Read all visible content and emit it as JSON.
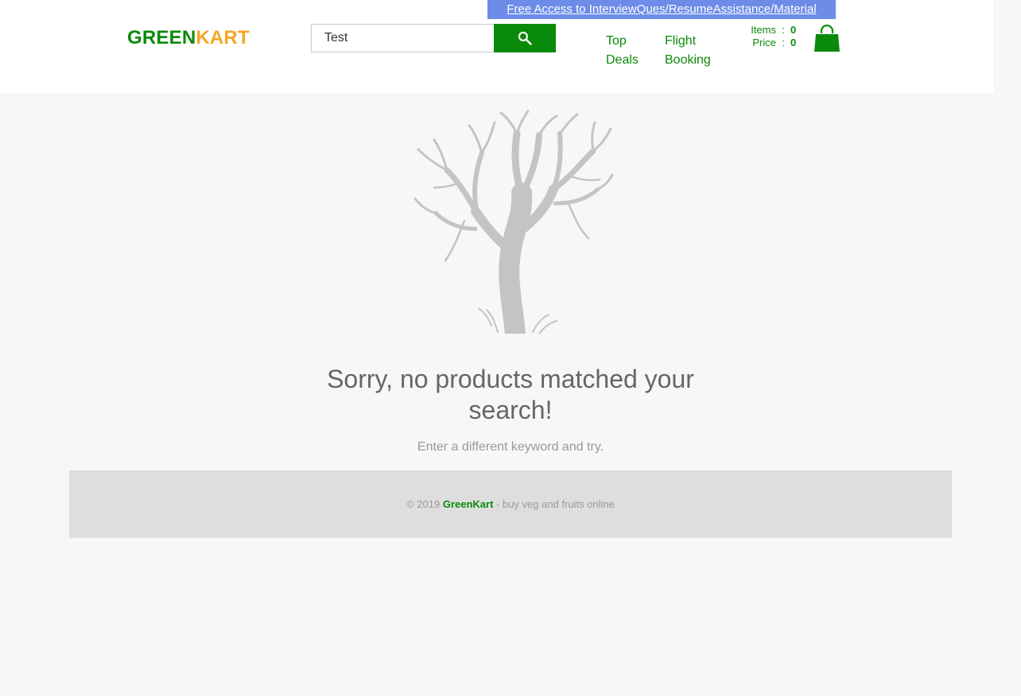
{
  "promo": {
    "label": "Free Access to InterviewQues/ResumeAssistance/Material"
  },
  "brand": {
    "part1": "GREEN",
    "part2": "KART",
    "color_primary": "#0a8a0a",
    "color_secondary": "#f5a623"
  },
  "search": {
    "value": "Test",
    "button_icon": "search-icon"
  },
  "nav": {
    "top_deals": "Top Deals",
    "flight_booking": "Flight Booking"
  },
  "cart": {
    "items_label": "Items",
    "items_value": "0",
    "price_label": "Price",
    "price_value": "0",
    "separator": ":",
    "icon": "shopping-bag-icon"
  },
  "empty_state": {
    "image": "bare-tree",
    "title": "Sorry, no products matched your search!",
    "subtitle": "Enter a different keyword and try."
  },
  "footer": {
    "copyright": "© 2019",
    "brand": "GreenKart",
    "tagline": "- buy veg and fruits online"
  }
}
